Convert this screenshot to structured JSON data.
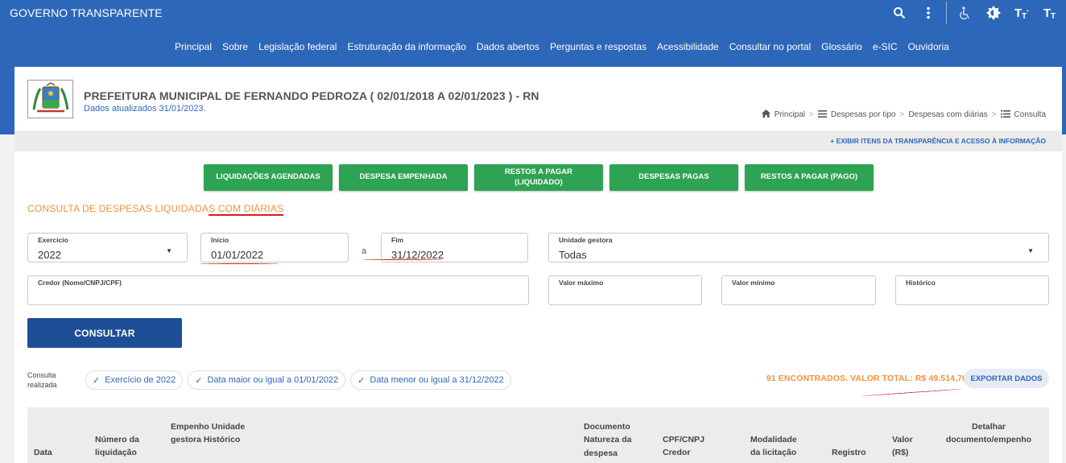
{
  "brand": "GOVERNO TRANSPARENTE",
  "top_icons": [
    "search-icon",
    "more-vert-icon",
    "accessibility-icon",
    "contrast-icon",
    "font-decrease-icon",
    "font-increase-icon"
  ],
  "nav": [
    "Principal",
    "Sobre",
    "Legislação federal",
    "Estruturação da informação",
    "Dados abertos",
    "Perguntas e respostas",
    "Acessibilidade",
    "Consultar no portal",
    "Glossário",
    "e-SIC",
    "Ouvidoria"
  ],
  "org": {
    "title": "PREFEITURA MUNICIPAL DE FERNANDO PEDROZA ( 02/01/2018 A 02/01/2023 ) - RN",
    "updated": "Dados atualizados 31/01/2023."
  },
  "breadcrumb": [
    "Principal",
    "Despesas por tipo",
    "Despesas com diárias",
    "Consulta"
  ],
  "transparency_link": "+ EXIBIR ITENS DA TRANSPARÊNCIA E ACESSO À INFORMAÇÃO",
  "action_buttons": [
    "LIQUIDAÇÕES AGENDADAS",
    "DESPESA EMPENHADA",
    "RESTOS A PAGAR (LIQUIDADO)",
    "DESPESAS PAGAS",
    "RESTOS A PAGAR (PAGO)"
  ],
  "consulta_title_a": "CONSULTA DE DESPESAS LIQUIDADA",
  "consulta_title_b": "S COM DIÁRIAS",
  "form": {
    "exercicio": {
      "label": "Exercício",
      "value": "2022"
    },
    "inicio": {
      "label": "Início",
      "value": "01/01/2022"
    },
    "sep": "a",
    "fim": {
      "label": "Fim",
      "value": "31/12/2022"
    },
    "unidade": {
      "label": "Unidade gestora",
      "value": "Todas"
    },
    "credor": {
      "label": "Credor (Nome/CNPJ/CPF)",
      "value": ""
    },
    "valor_max": {
      "label": "Valor máximo",
      "value": ""
    },
    "valor_min": {
      "label": "Valor mínimo",
      "value": ""
    },
    "historico": {
      "label": "Histórico",
      "value": ""
    }
  },
  "consultar_label": "CONSULTAR",
  "consulta_realizada": "Consulta realizada",
  "chips": [
    "Exercício de 2022",
    "Data maior ou igual a 01/01/2022",
    "Data menor ou igual a 31/12/2022"
  ],
  "found_text": "91 ENCONTRADOS. VALOR TOTAL: R$ 49.514,78",
  "export_label": "EXPORTAR DADOS",
  "table_headers": {
    "data": "Data",
    "numero": "Número da liquidação",
    "empenho": "Empenho Unidade gestora Histórico",
    "documento": "Documento Natureza da despesa",
    "cpf": "CPF/CNPJ Credor",
    "modalidade": "Modalidade da licitação",
    "registro": "Registro",
    "valor": "Valor (R$)",
    "detalhar": "Detalhar documento/empenho"
  }
}
